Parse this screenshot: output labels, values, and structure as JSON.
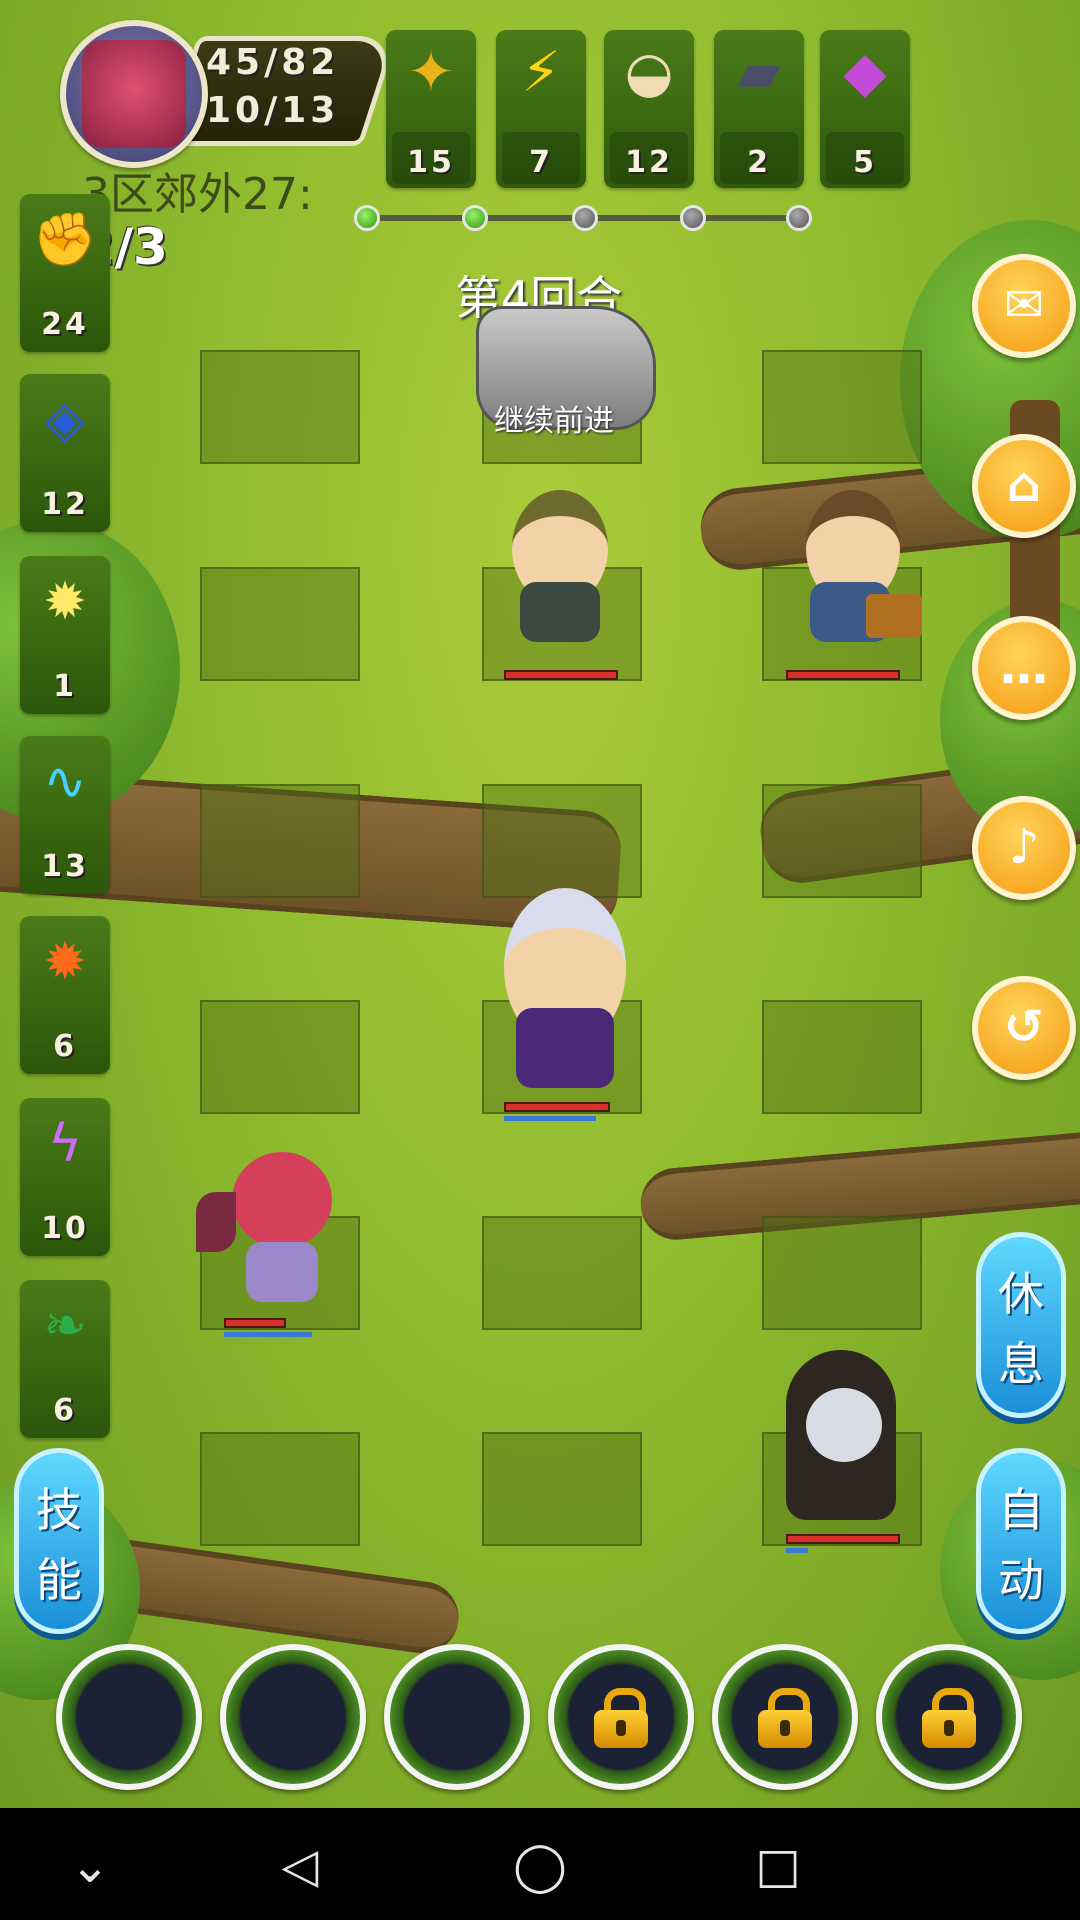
{
  "player": {
    "hp_text": "45/82",
    "energy_text": "10/13"
  },
  "resources": [
    {
      "icon": "gold-coin-icon",
      "value": "15"
    },
    {
      "icon": "lightning-icon",
      "value": "7"
    },
    {
      "icon": "dumpling-icon",
      "value": "12"
    },
    {
      "icon": "iron-ingot-icon",
      "value": "2"
    },
    {
      "icon": "crystal-icon",
      "value": "5"
    }
  ],
  "stage": {
    "name": "3区郊外27:",
    "wave": "2/3",
    "round": "第4回合",
    "continue_hint": "继续前进",
    "progress_total": 5,
    "progress_done": 2
  },
  "skills": [
    {
      "icon": "fist-icon",
      "value": "24"
    },
    {
      "icon": "shield-icon",
      "value": "12"
    },
    {
      "icon": "holy-flame-icon",
      "value": "1"
    },
    {
      "icon": "water-wave-icon",
      "value": "13"
    },
    {
      "icon": "fire-icon",
      "value": "6"
    },
    {
      "icon": "purple-lightning-icon",
      "value": "10"
    },
    {
      "icon": "green-worm-icon",
      "value": "6"
    }
  ],
  "right_buttons": [
    {
      "icon": "mail-icon"
    },
    {
      "icon": "home-icon"
    },
    {
      "icon": "chat-icon"
    },
    {
      "icon": "sound-icon"
    },
    {
      "icon": "back-arrow-icon"
    }
  ],
  "actions": {
    "skill": [
      "技",
      "能"
    ],
    "rest": [
      "休",
      "息"
    ],
    "auto": [
      "自",
      "动"
    ]
  },
  "slots": [
    {
      "locked": false
    },
    {
      "locked": false
    },
    {
      "locked": false
    },
    {
      "locked": true
    },
    {
      "locked": true
    },
    {
      "locked": true
    }
  ],
  "units": [
    {
      "name": "bandana-enemy",
      "hp": 1.0
    },
    {
      "name": "treasure-enemy",
      "hp": 1.0
    },
    {
      "name": "warrior-hero",
      "hp": 1.0,
      "mp": 0.85
    },
    {
      "name": "demon-girl-ally",
      "hp": 0.7,
      "mp": 1.0
    },
    {
      "name": "skeleton-enemy",
      "hp": 1.0,
      "mp": 0.2
    }
  ],
  "colors": {
    "accent_orange": "#f59a10",
    "pill_blue": "#1a8fd8",
    "hp_red": "#d8302a",
    "mp_blue": "#3a78d8"
  }
}
